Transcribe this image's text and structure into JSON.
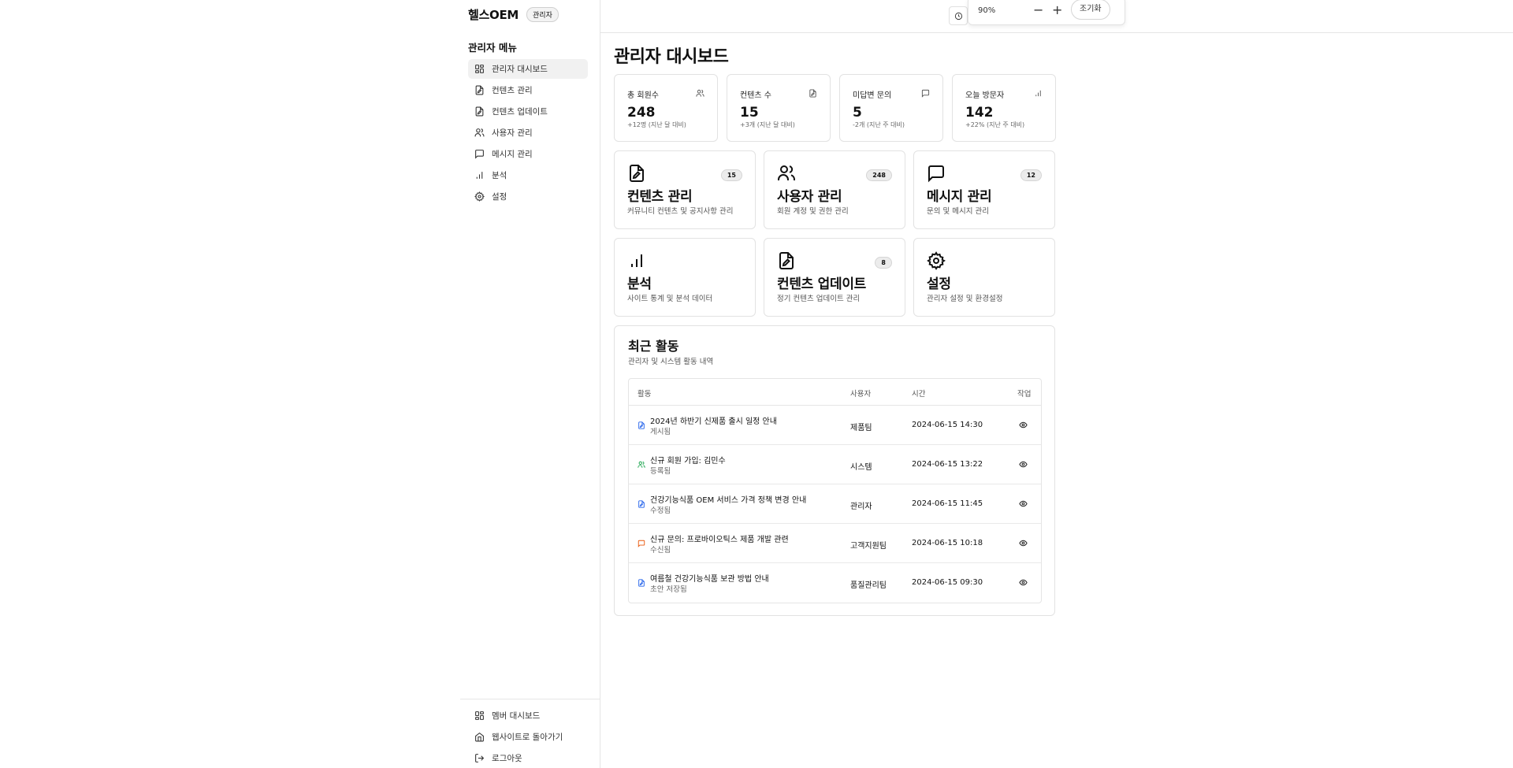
{
  "brand": {
    "name": "헬스OEM",
    "role_badge": "관리자"
  },
  "sidebar": {
    "heading": "관리자 메뉴",
    "items": [
      {
        "label": "관리자 대시보드",
        "icon": "dashboard-icon"
      },
      {
        "label": "컨텐츠 관리",
        "icon": "file-edit-icon"
      },
      {
        "label": "컨텐츠 업데이트",
        "icon": "file-edit-icon"
      },
      {
        "label": "사용자 관리",
        "icon": "users-icon"
      },
      {
        "label": "메시지 관리",
        "icon": "message-icon"
      },
      {
        "label": "분석",
        "icon": "bar-chart-icon"
      },
      {
        "label": "설정",
        "icon": "gear-icon"
      }
    ],
    "bottom_items": [
      {
        "label": "멤버 대시보드",
        "icon": "dashboard-icon"
      },
      {
        "label": "웹사이트로 돌아가기",
        "icon": "home-icon"
      },
      {
        "label": "로그아웃",
        "icon": "logout-icon"
      }
    ]
  },
  "topbar": {
    "zoom": {
      "level": "90%",
      "decrease": "−",
      "increase": "+",
      "reset": "조기화"
    }
  },
  "main": {
    "title": "관리자 대시보드",
    "stats": [
      {
        "label": "총 회원수",
        "value": "248",
        "delta": "+12명 (지난 달 대비)",
        "icon": "users-icon"
      },
      {
        "label": "컨텐츠 수",
        "value": "15",
        "delta": "+3개 (지난 달 대비)",
        "icon": "file-edit-icon"
      },
      {
        "label": "미답변 문의",
        "value": "5",
        "delta": "-2개 (지난 주 대비)",
        "icon": "message-icon"
      },
      {
        "label": "오늘 방문자",
        "value": "142",
        "delta": "+22% (지난 주 대비)",
        "icon": "bar-chart-icon"
      }
    ],
    "features": [
      {
        "title": "컨텐츠 관리",
        "desc": "커뮤니티 컨텐츠 및 공지사항 관리",
        "badge": "15",
        "icon": "file-edit-icon"
      },
      {
        "title": "사용자 관리",
        "desc": "회원 계정 및 권한 관리",
        "badge": "248",
        "icon": "users-icon"
      },
      {
        "title": "메시지 관리",
        "desc": "문의 및 메시지 관리",
        "badge": "12",
        "icon": "message-icon"
      },
      {
        "title": "분석",
        "desc": "사이트 통계 및 분석 데이터",
        "badge": "",
        "icon": "bar-chart-icon"
      },
      {
        "title": "컨텐츠 업데이트",
        "desc": "정기 컨텐츠 업데이트 관리",
        "badge": "8",
        "icon": "file-edit-icon"
      },
      {
        "title": "설정",
        "desc": "관리자 설정 및 환경설정",
        "badge": "",
        "icon": "gear-icon"
      }
    ],
    "activity": {
      "title": "최근 활동",
      "subtitle": "관리자 및 시스템 활동 내역",
      "columns": [
        "활동",
        "사용자",
        "시간",
        "작업"
      ],
      "rows": [
        {
          "title": "2024년 하반기 신제품 출시 일정 안내",
          "status": "게시됨",
          "user": "제품팀",
          "time": "2024-06-15 14:30",
          "icon": "file-edit-icon",
          "color": "#2563eb"
        },
        {
          "title": "신규 회원 가입: 김민수",
          "status": "등록됨",
          "user": "시스템",
          "time": "2024-06-15 13:22",
          "icon": "users-icon",
          "color": "#16a34a"
        },
        {
          "title": "건강기능식품 OEM 서비스 가격 정책 변경 안내",
          "status": "수정됨",
          "user": "관리자",
          "time": "2024-06-15 11:45",
          "icon": "file-edit-icon",
          "color": "#2563eb"
        },
        {
          "title": "신규 문의: 프로바이오틱스 제품 개발 관련",
          "status": "수신됨",
          "user": "고객지원팀",
          "time": "2024-06-15 10:18",
          "icon": "message-icon",
          "color": "#ea580c"
        },
        {
          "title": "여름철 건강기능식품 보관 방법 안내",
          "status": "초안 저장됨",
          "user": "품질관리팀",
          "time": "2024-06-15 09:30",
          "icon": "file-edit-icon",
          "color": "#2563eb"
        }
      ]
    }
  }
}
